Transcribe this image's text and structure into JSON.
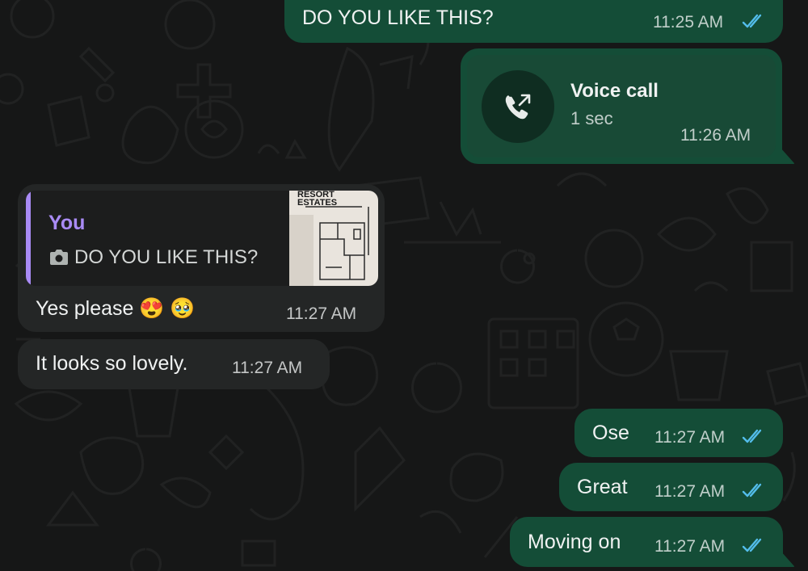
{
  "colors": {
    "outgoing_bubble": "#144d37",
    "incoming_bubble": "#242626",
    "read_ticks": "#53bdeb",
    "quote_accent": "#a98bf5",
    "background": "#161717"
  },
  "messages": [
    {
      "direction": "outgoing",
      "text": "DO YOU LIKE THIS?",
      "time": "11:25 AM",
      "status": "read",
      "status_icon": "double-check-icon"
    },
    {
      "direction": "outgoing",
      "type": "voice-call",
      "title": "Voice call",
      "duration": "1 sec",
      "time": "11:26 AM",
      "icon": "outgoing-call-icon"
    },
    {
      "direction": "incoming",
      "quote": {
        "author": "You",
        "text": "DO YOU LIKE THIS?",
        "icon": "camera-icon",
        "thumbnail_caption": "RESORT ESTATES"
      },
      "text": "Yes please 😍 🥹",
      "time": "11:27 AM"
    },
    {
      "direction": "incoming",
      "text": "It looks so lovely.",
      "time": "11:27 AM"
    },
    {
      "direction": "outgoing",
      "text": "Ose",
      "time": "11:27 AM",
      "status": "read",
      "status_icon": "double-check-icon"
    },
    {
      "direction": "outgoing",
      "text": "Great",
      "time": "11:27 AM",
      "status": "read",
      "status_icon": "double-check-icon"
    },
    {
      "direction": "outgoing",
      "text": "Moving on",
      "time": "11:27 AM",
      "status": "read",
      "status_icon": "double-check-icon"
    }
  ]
}
